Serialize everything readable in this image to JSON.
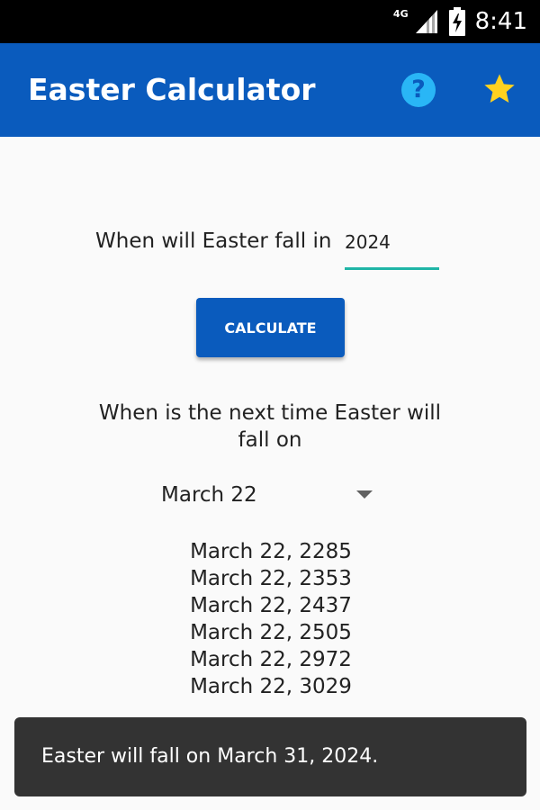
{
  "status_bar": {
    "network_type": "4G",
    "time": "8:41",
    "icons": [
      "signal-icon",
      "battery-charging-icon"
    ]
  },
  "app_bar": {
    "title": "Easter Calculator",
    "help_icon": "help-circle-icon",
    "favorite_icon": "star-icon",
    "bar_color": "#0a5bbd"
  },
  "form": {
    "year_label": "When will Easter fall in",
    "year_value": "2024",
    "calculate_label": "CALCULATE"
  },
  "next_section": {
    "label": "When is the next time Easter will fall on",
    "selected_date": "March 22",
    "results": [
      "March 22, 2285",
      "March 22, 2353",
      "March 22, 2437",
      "March 22, 2505",
      "March 22, 2972",
      "March 22, 3029"
    ]
  },
  "snackbar": {
    "message": "Easter will fall on March 31, 2024."
  }
}
